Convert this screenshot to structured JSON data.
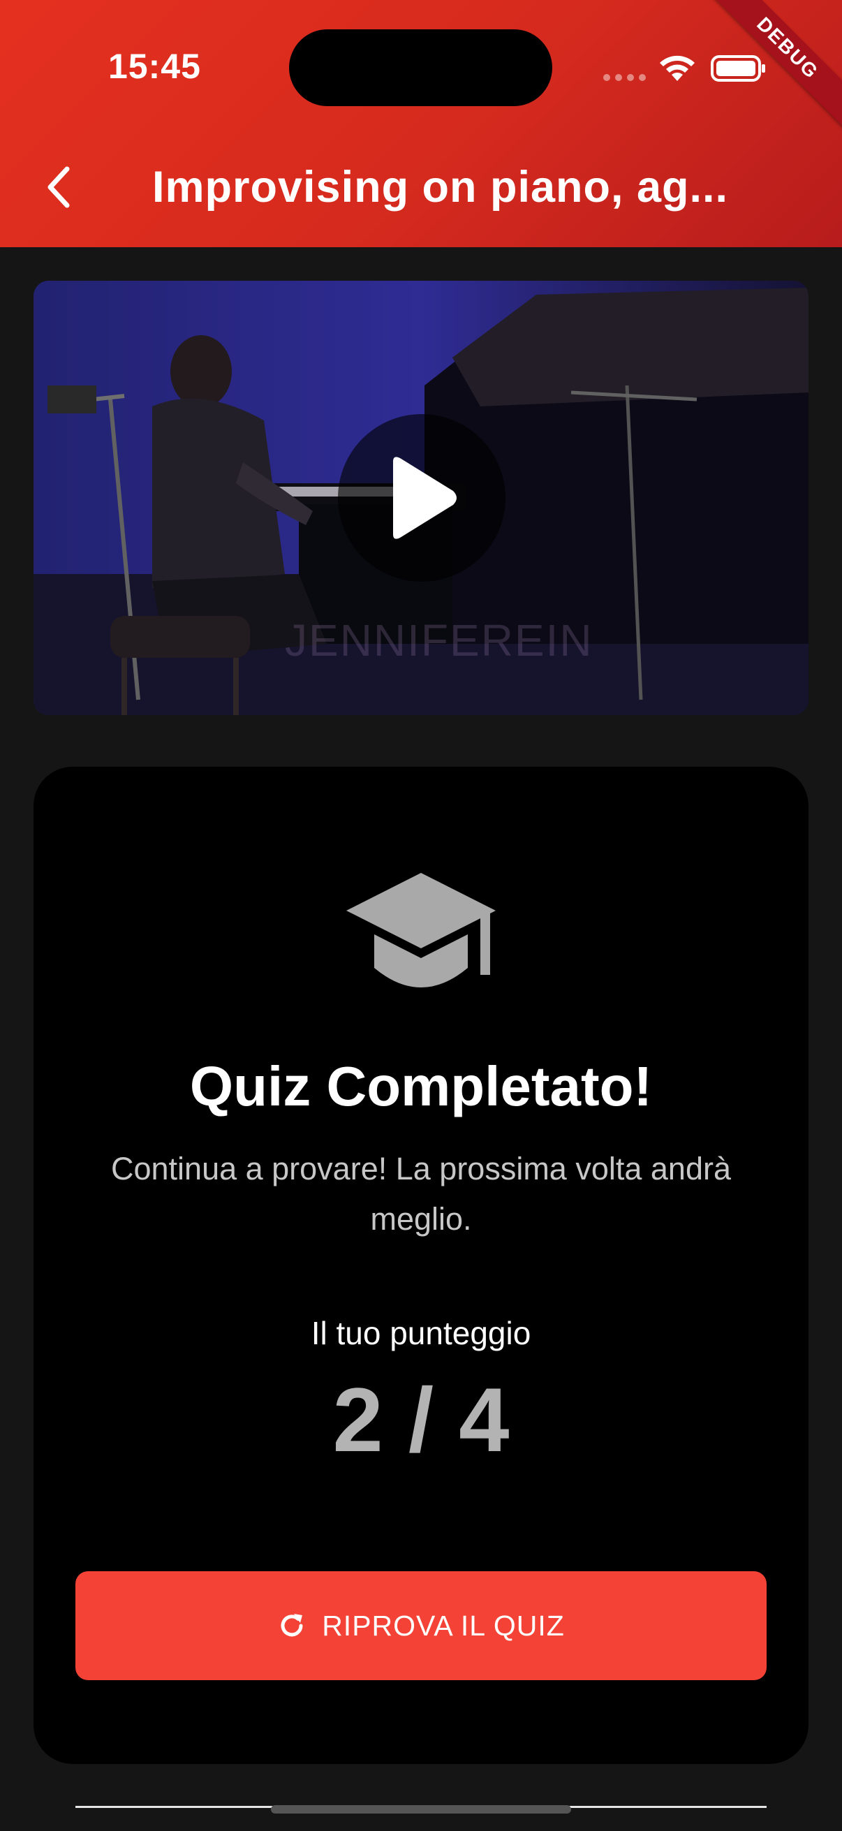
{
  "status_bar": {
    "time": "15:45"
  },
  "debug_banner": {
    "label": "DEBUG"
  },
  "header": {
    "title": "Improvising on piano, ag...",
    "back_icon": "chevron-left-icon"
  },
  "video": {
    "watermark": "JENNIFEREIN",
    "play_icon": "play-icon"
  },
  "quiz_result": {
    "icon": "graduation-cap-icon",
    "title": "Quiz Completato!",
    "message": "Continua a provare! La prossima volta andrà meglio.",
    "score_label": "Il tuo punteggio",
    "score": "2 / 4",
    "retry_button": {
      "icon": "refresh-icon",
      "label": "RIPROVA IL QUIZ"
    }
  },
  "colors": {
    "appbar_red": "#e4301f",
    "button_red": "#f44336",
    "background": "#151515",
    "card": "#000000",
    "score_grey": "#b3b3b3"
  }
}
